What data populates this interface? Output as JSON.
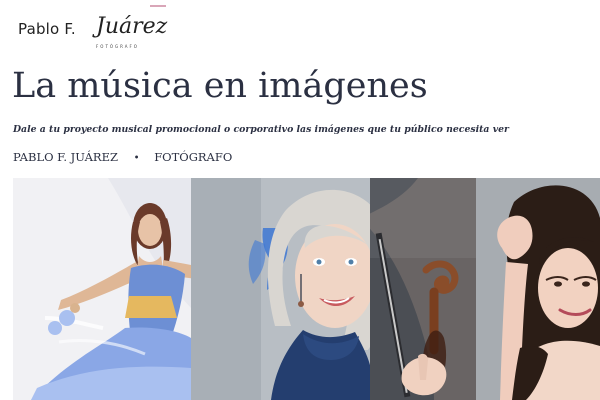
{
  "brand": {
    "logo_name": "Pablo F.",
    "logo_script": "Juárez",
    "logo_sub": "FOTÓGRAFO"
  },
  "hero": {
    "title": "La música en imágenes",
    "subtitle": "Dale a tu proyecto musical promocional o corporativo las imágenes que tu público necesita ver",
    "byline_name": "PABLO F. JUÁREZ",
    "byline_separator": "•",
    "byline_role": "FOTÓGRAFO"
  },
  "colors": {
    "title": "#2b3042",
    "accent": "#d9a6b8"
  },
  "photos": [
    {
      "subject": "singer-in-blue-gown"
    },
    {
      "subject": "smiling-blonde-woman"
    },
    {
      "subject": "violin-closeup"
    },
    {
      "subject": "woman-with-hand-in-hair"
    }
  ]
}
